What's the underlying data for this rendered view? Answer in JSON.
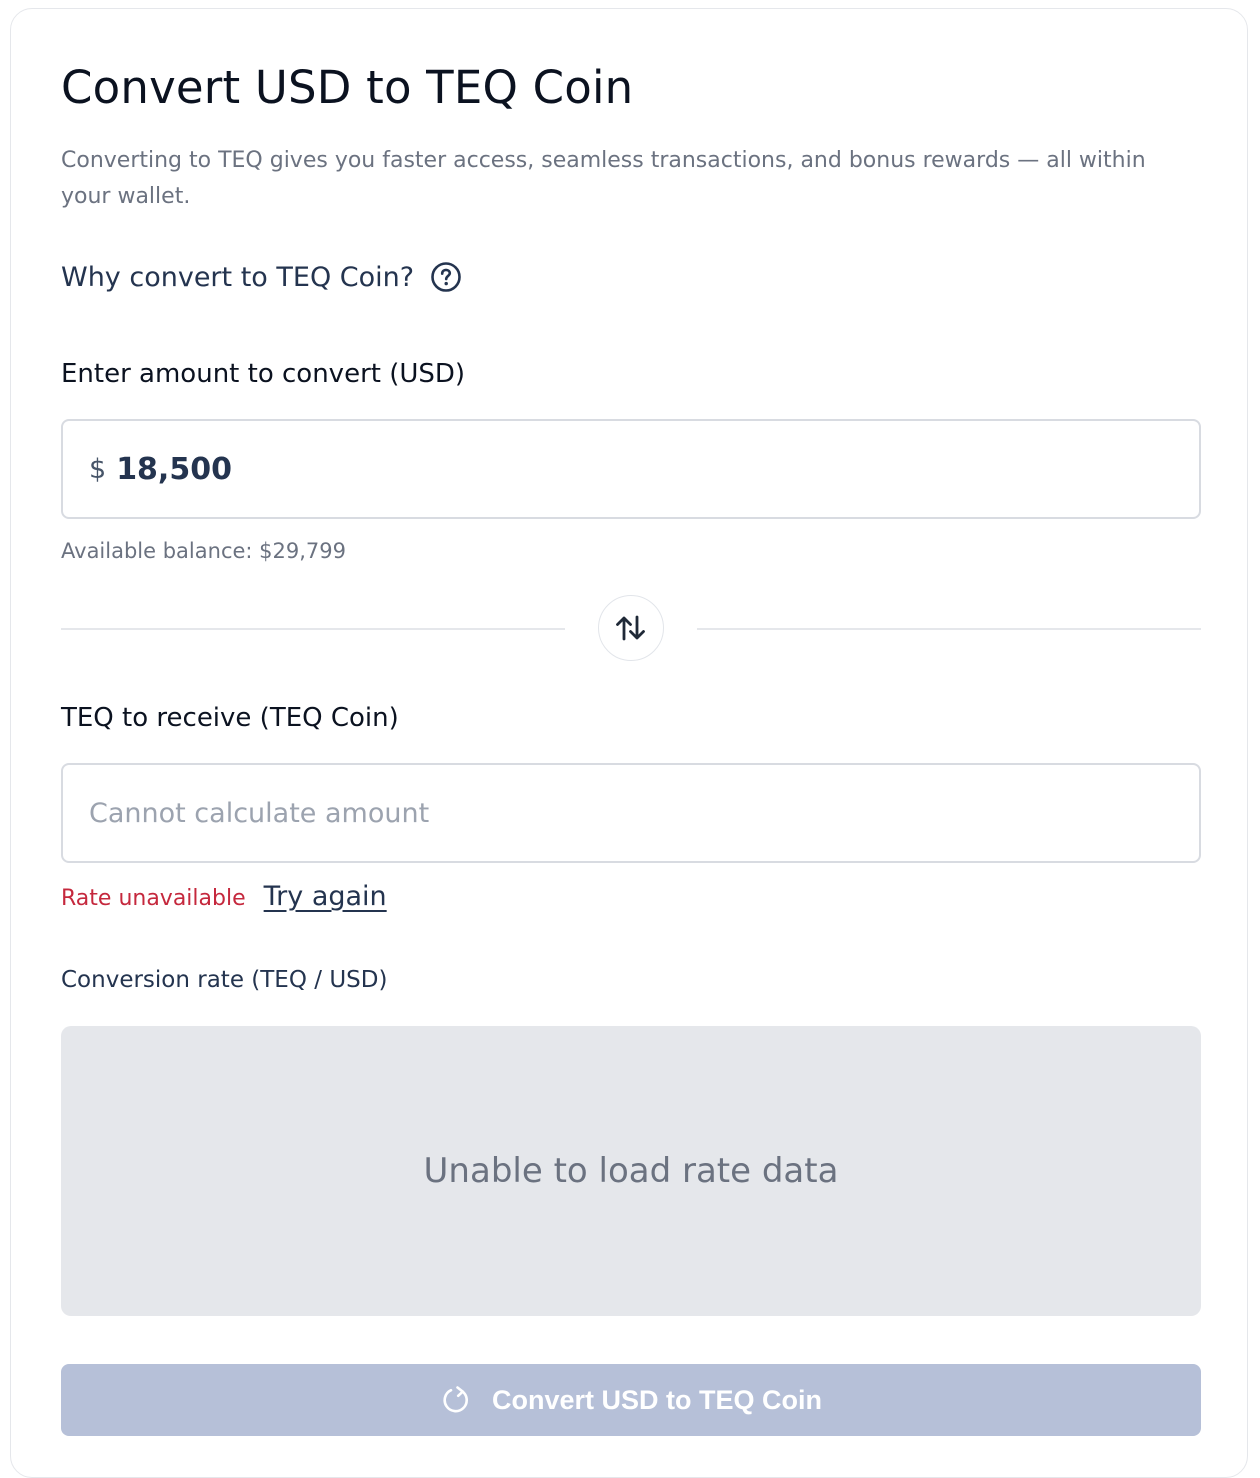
{
  "header": {
    "title": "Convert USD to TEQ Coin",
    "subtitle": "Converting to TEQ gives you faster access, seamless transactions, and bonus rewards — all within your wallet."
  },
  "info_link": {
    "label": "Why convert to TEQ Coin?",
    "icon": "help-circle-icon"
  },
  "usd_field": {
    "label": "Enter amount to convert (USD)",
    "currency_symbol": "$",
    "value": "18,500",
    "balance_text": "Available balance: $29,799"
  },
  "swap": {
    "icon": "swap-vertical-icon"
  },
  "teq_field": {
    "label": "TEQ to receive (TEQ Coin)",
    "value": "",
    "placeholder": "Cannot calculate amount",
    "error_text": "Rate unavailable",
    "retry_label": "Try again"
  },
  "rate": {
    "label": "Conversion rate (TEQ / USD)",
    "empty_message": "Unable to load rate data"
  },
  "submit": {
    "label": "Convert USD to TEQ Coin",
    "icon": "refresh-icon",
    "enabled": false
  },
  "colors": {
    "primary_text": "#24344f",
    "error": "#c5283d",
    "disabled_button": "#b6c0d8",
    "rate_box_bg": "#e5e7eb"
  }
}
